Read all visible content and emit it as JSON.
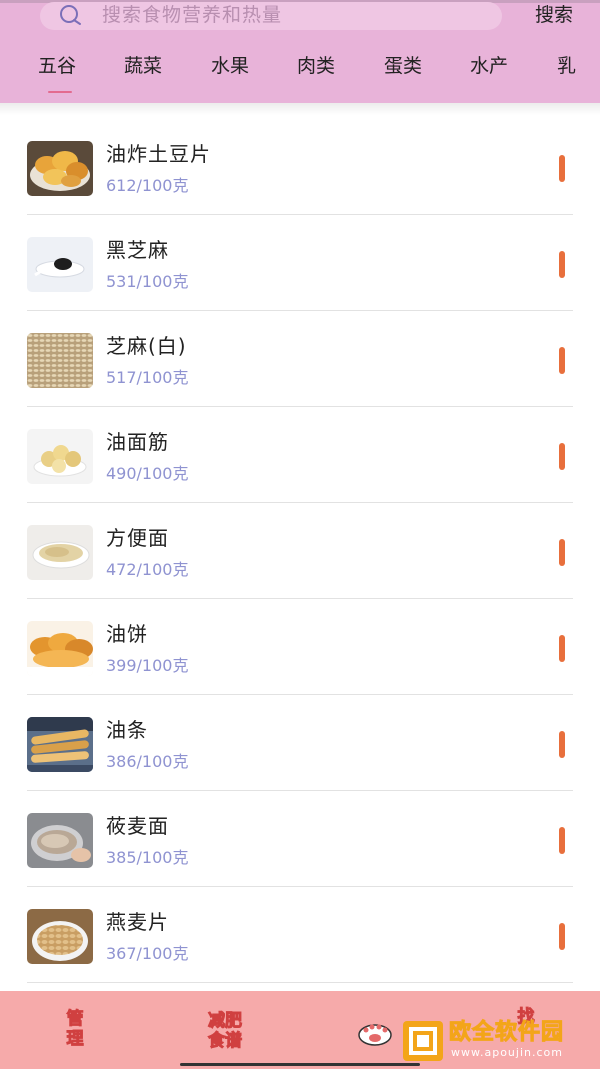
{
  "search": {
    "placeholder": "搜索食物营养和热量",
    "button_label": "搜索",
    "icon": "search-icon"
  },
  "tabs": [
    "五谷",
    "蔬菜",
    "水果",
    "肉类",
    "蛋类",
    "水产",
    "乳"
  ],
  "active_tab_index": 0,
  "foods": [
    {
      "name": "油炸土豆片",
      "calories": "612/100克",
      "icon": "chips-photo"
    },
    {
      "name": "黑芝麻",
      "calories": "531/100克",
      "icon": "black-sesame-photo"
    },
    {
      "name": "芝麻(白)",
      "calories": "517/100克",
      "icon": "white-sesame-photo"
    },
    {
      "name": "油面筋",
      "calories": "490/100克",
      "icon": "gluten-ball-photo"
    },
    {
      "name": "方便面",
      "calories": "472/100克",
      "icon": "instant-noodle-photo"
    },
    {
      "name": "油饼",
      "calories": "399/100克",
      "icon": "pancake-photo"
    },
    {
      "name": "油条",
      "calories": "386/100克",
      "icon": "fried-dough-photo"
    },
    {
      "name": "莜麦面",
      "calories": "385/100克",
      "icon": "oat-flour-photo"
    },
    {
      "name": "燕麦片",
      "calories": "367/100克",
      "icon": "oatmeal-photo"
    }
  ],
  "footer": {
    "tab1_line1": "管",
    "tab1_line2": "理",
    "tab2_line1": "减肥",
    "tab2_line2": "食谱",
    "tab3_partial": "找"
  },
  "watermark": {
    "title": "欧全软件园",
    "subtitle": "www.apoujin.com"
  },
  "colors": {
    "header": "#e8b3d9",
    "footer": "#f6aaaa",
    "calorie_text": "#8f93d1",
    "marker": "#e86f3c"
  }
}
